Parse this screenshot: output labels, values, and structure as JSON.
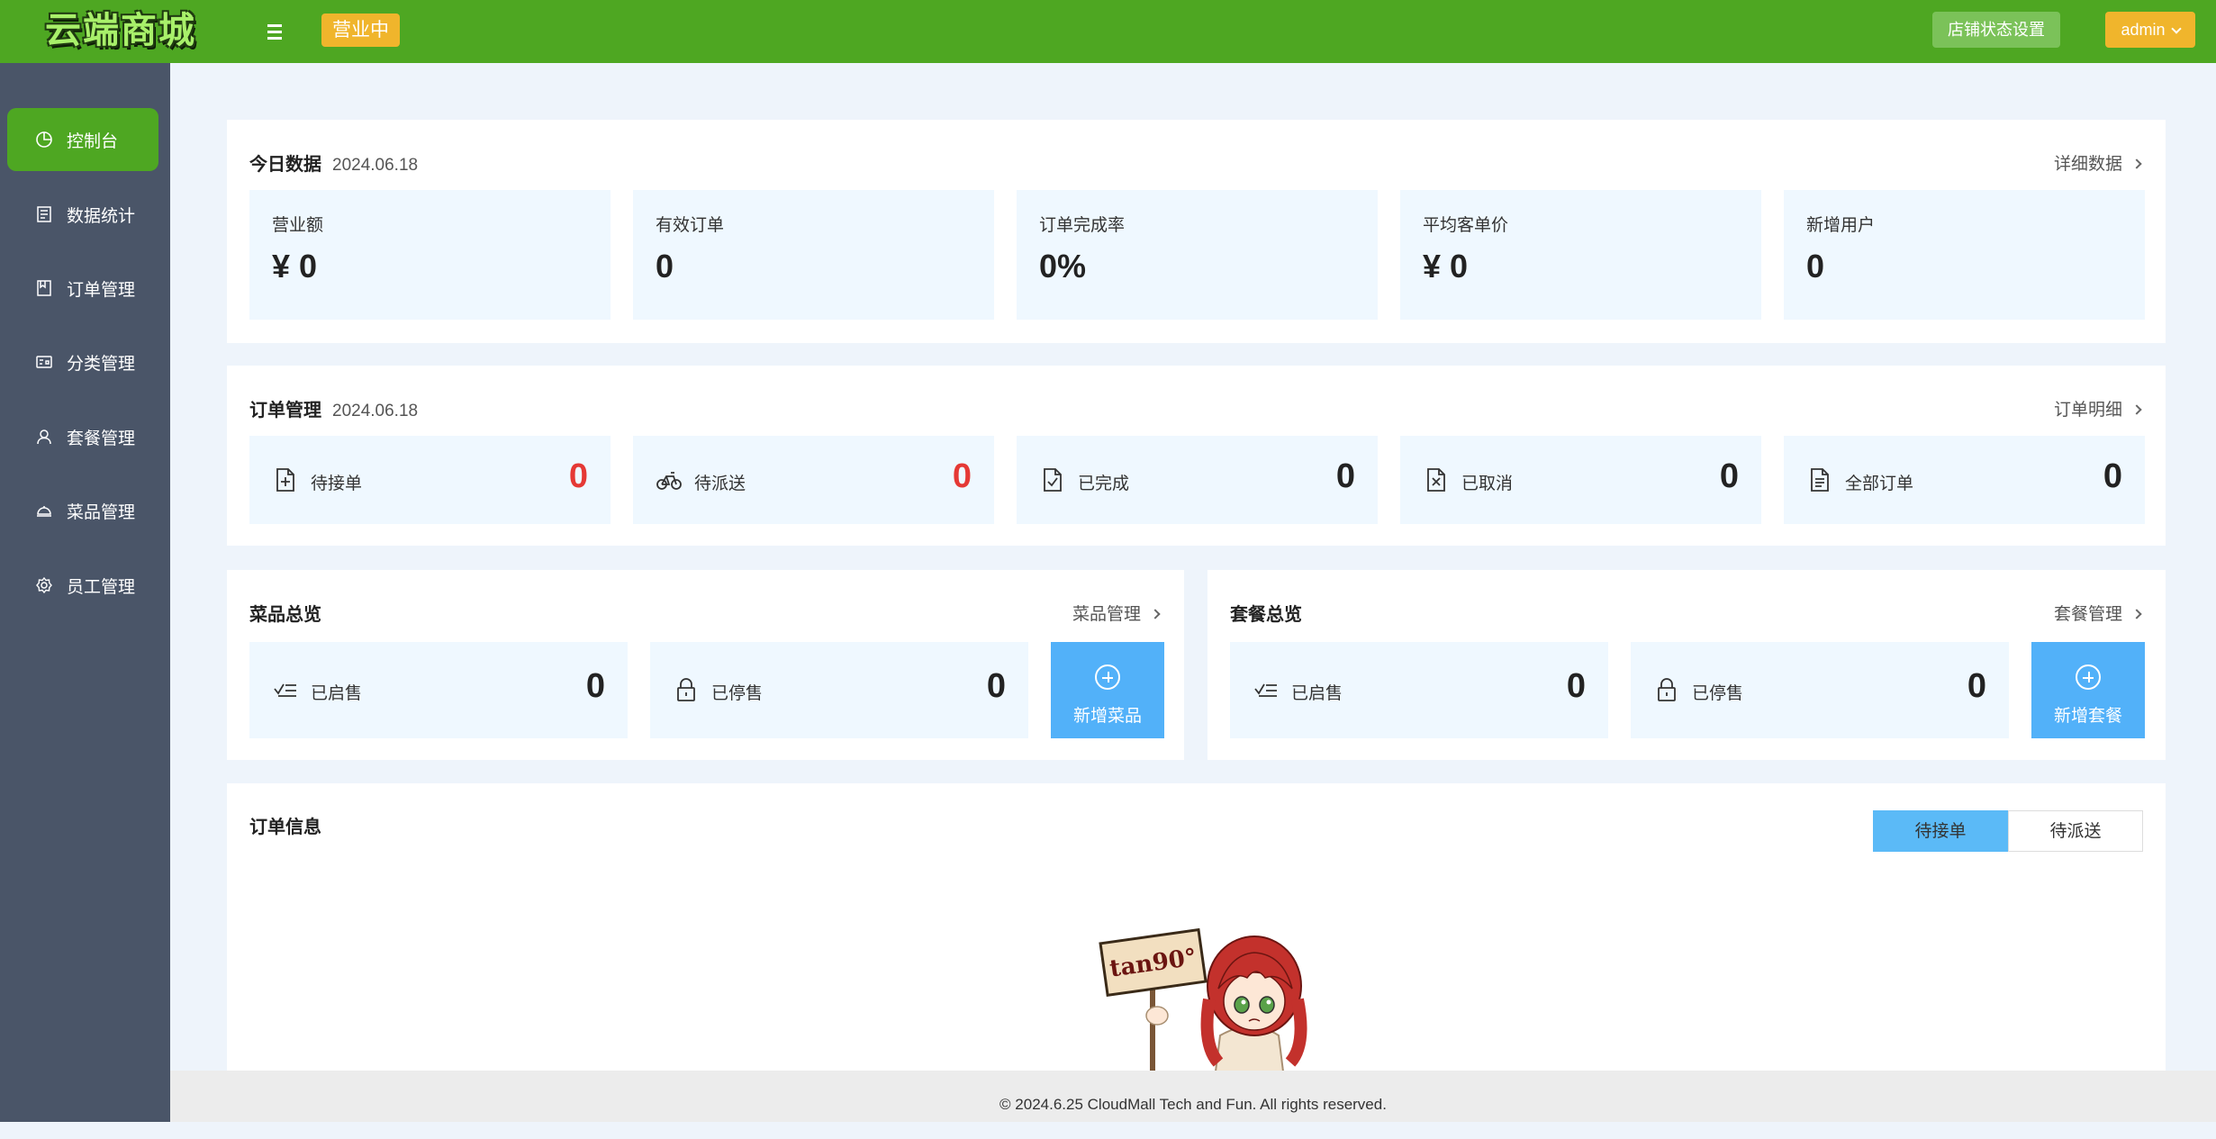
{
  "header": {
    "logo_text": "云端商城",
    "status": "营业中",
    "store_settings": "店铺状态设置",
    "user": "admin"
  },
  "sidebar": {
    "items": [
      {
        "label": "控制台",
        "icon": "pie-chart-icon",
        "active": true
      },
      {
        "label": "数据统计",
        "icon": "document-icon"
      },
      {
        "label": "订单管理",
        "icon": "order-icon"
      },
      {
        "label": "分类管理",
        "icon": "category-icon"
      },
      {
        "label": "套餐管理",
        "icon": "user-icon"
      },
      {
        "label": "菜品管理",
        "icon": "dish-icon"
      },
      {
        "label": "员工管理",
        "icon": "gear-icon"
      }
    ]
  },
  "today": {
    "title": "今日数据",
    "date": "2024.06.18",
    "link": "详细数据",
    "stats": [
      {
        "label": "营业额",
        "value": "¥ 0"
      },
      {
        "label": "有效订单",
        "value": "0"
      },
      {
        "label": "订单完成率",
        "value": "0%"
      },
      {
        "label": "平均客单价",
        "value": "¥ 0"
      },
      {
        "label": "新增用户",
        "value": "0"
      }
    ]
  },
  "orders": {
    "title": "订单管理",
    "date": "2024.06.18",
    "link": "订单明细",
    "items": [
      {
        "label": "待接单",
        "value": "0",
        "icon": "add-file-icon",
        "color": "#e53935"
      },
      {
        "label": "待派送",
        "value": "0",
        "icon": "bicycle-icon",
        "color": "#e53935"
      },
      {
        "label": "已完成",
        "value": "0",
        "icon": "check-file-icon"
      },
      {
        "label": "已取消",
        "value": "0",
        "icon": "cancel-file-icon"
      },
      {
        "label": "全部订单",
        "value": "0",
        "icon": "list-file-icon"
      }
    ]
  },
  "dishes": {
    "title": "菜品总览",
    "link": "菜品管理",
    "on_sale": {
      "label": "已启售",
      "value": "0"
    },
    "off_sale": {
      "label": "已停售",
      "value": "0"
    },
    "add_button": "新增菜品"
  },
  "setmeals": {
    "title": "套餐总览",
    "link": "套餐管理",
    "on_sale": {
      "label": "已启售",
      "value": "0"
    },
    "off_sale": {
      "label": "已停售",
      "value": "0"
    },
    "add_button": "新增套餐"
  },
  "order_info": {
    "title": "订单信息",
    "tabs": [
      "待接单",
      "待派送"
    ],
    "active_tab": "待接单",
    "empty_sign": "tan90°"
  },
  "footer": {
    "text": "© 2024.6.25 CloudMall Tech and Fun. All rights reserved."
  },
  "colors": {
    "header": "#4ea722",
    "sidebar": "#4a5568",
    "accent_yellow": "#f0b52c",
    "accent_blue": "#52b1f9",
    "alert_red": "#e53935"
  }
}
